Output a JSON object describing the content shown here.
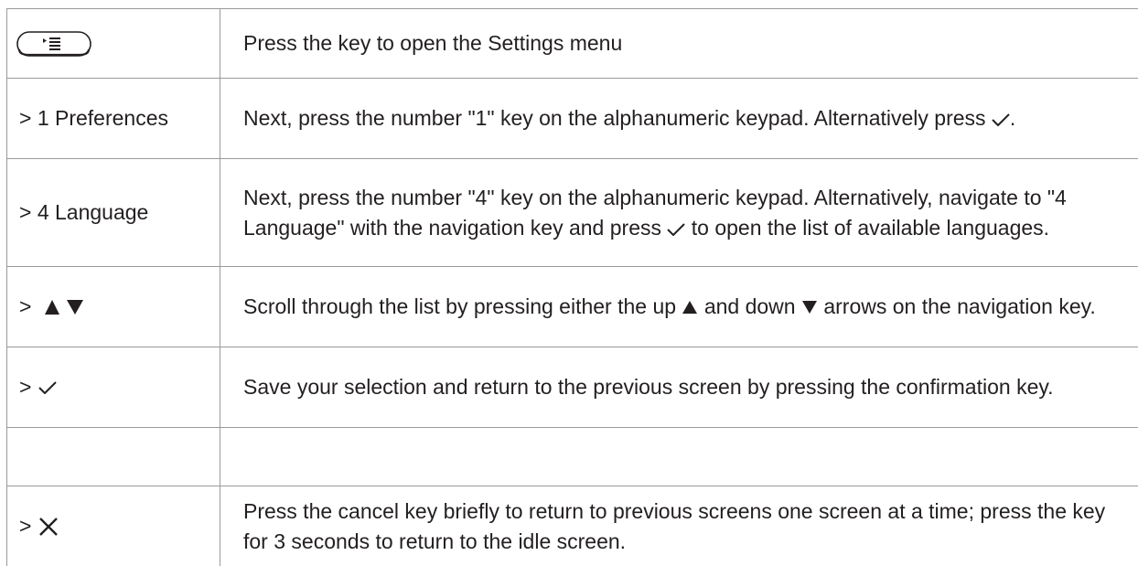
{
  "rows": [
    {
      "left": "",
      "left_icon": "settings-key-icon",
      "right": [
        "Press the key to open the Settings menu"
      ]
    },
    {
      "left": "> 1 Preferences",
      "right": [
        "Next, press the number \"1\" key on the alphanumeric keypad.  Alternatively press",
        "."
      ]
    },
    {
      "left": "> 4 Language",
      "right": [
        "Next, press the number \"4\" key on the alphanumeric keypad.  Alternatively, navigate to \"4 Language\" with the navigation key and press",
        "to open the list of available languages."
      ]
    },
    {
      "left": ">",
      "left_icon": "up-down-arrows-icon",
      "right": [
        "Scroll through the list by pressing either the up",
        "and down",
        "arrows on the navigation key."
      ]
    },
    {
      "left": ">",
      "left_icon": "checkmark-icon",
      "right": [
        "Save your selection and return to the previous screen by pressing the confirmation key."
      ]
    },
    {
      "left": ">",
      "left_icon": "cancel-x-icon",
      "right": [
        "Press the cancel key briefly to return to previous screens one screen at a time;  press the key for 3 seconds to return to the idle screen."
      ]
    }
  ],
  "colors": {
    "text": "#231f20",
    "rule": "#9a9a9a"
  }
}
